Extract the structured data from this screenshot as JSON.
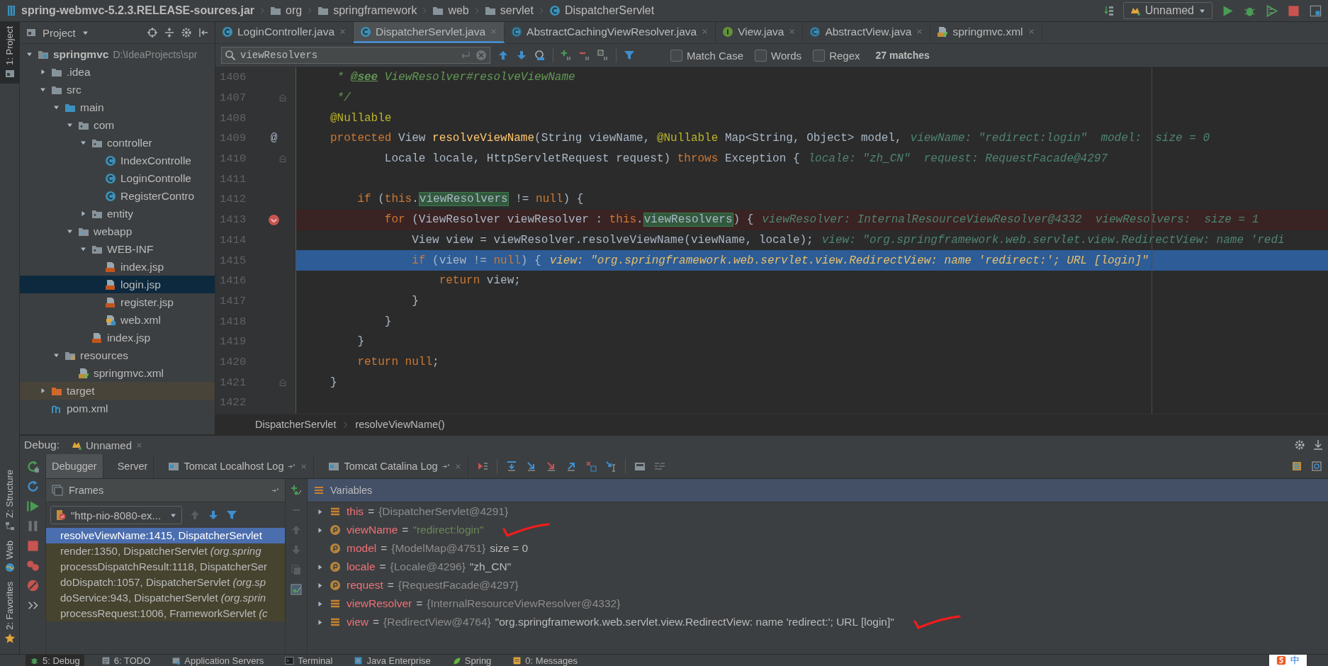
{
  "breadcrumb": [
    {
      "kind": "jar",
      "label": "spring-webmvc-5.2.3.RELEASE-sources.jar"
    },
    {
      "kind": "folder",
      "label": "org"
    },
    {
      "kind": "folder",
      "label": "springframework"
    },
    {
      "kind": "folder",
      "label": "web"
    },
    {
      "kind": "folder",
      "label": "servlet"
    },
    {
      "kind": "class",
      "label": "DispatcherServlet"
    }
  ],
  "run_config": {
    "label": "Unnamed"
  },
  "left_tools_top": [
    {
      "label": "1: Project",
      "kind": "project",
      "selected": true
    }
  ],
  "left_tools_bottom": [
    {
      "label": "Z: Structure",
      "kind": "structure",
      "selected": false
    },
    {
      "label": "Web",
      "kind": "web",
      "selected": false
    },
    {
      "label": "2: Favorites",
      "kind": "favorites",
      "selected": false
    }
  ],
  "project": {
    "title": "Project",
    "tree": [
      {
        "label": "springmvc",
        "path": "D:\\IdeaProjects\\spr",
        "kind": "module",
        "expanded": true,
        "selected": false,
        "children": [
          {
            "label": ".idea",
            "kind": "folder",
            "expanded": false,
            "selected": false
          },
          {
            "label": "src",
            "kind": "folder",
            "expanded": true,
            "selected": false,
            "children": [
              {
                "label": "main",
                "kind": "source",
                "expanded": true,
                "selected": false,
                "children": [
                  {
                    "label": "com",
                    "kind": "package",
                    "expanded": true,
                    "selected": false,
                    "children": [
                      {
                        "label": "controller",
                        "kind": "package",
                        "expanded": true,
                        "selected": false,
                        "children": [
                          {
                            "label": "IndexControlle",
                            "kind": "class",
                            "selected": false
                          },
                          {
                            "label": "LoginControlle",
                            "kind": "class",
                            "selected": false
                          },
                          {
                            "label": "RegisterContro",
                            "kind": "class",
                            "selected": false
                          }
                        ]
                      },
                      {
                        "label": "entity",
                        "kind": "package",
                        "expanded": false,
                        "selected": false
                      }
                    ]
                  },
                  {
                    "label": "webapp",
                    "kind": "webfolder",
                    "expanded": true,
                    "selected": false,
                    "children": [
                      {
                        "label": "WEB-INF",
                        "kind": "package",
                        "expanded": true,
                        "selected": false,
                        "children": [
                          {
                            "label": "index.jsp",
                            "kind": "jsp",
                            "selected": false
                          },
                          {
                            "label": "login.jsp",
                            "kind": "jsp",
                            "selected": true
                          },
                          {
                            "label": "register.jsp",
                            "kind": "jsp",
                            "selected": false
                          },
                          {
                            "label": "web.xml",
                            "kind": "webxml",
                            "selected": false
                          }
                        ]
                      },
                      {
                        "label": "index.jsp",
                        "kind": "jsp",
                        "selected": false
                      }
                    ]
                  }
                ]
              },
              {
                "label": "resources",
                "kind": "resources",
                "expanded": true,
                "selected": false,
                "children": [
                  {
                    "label": "springmvc.xml",
                    "kind": "springxml",
                    "selected": false
                  }
                ]
              }
            ]
          },
          {
            "label": "target",
            "kind": "excluded",
            "expanded": false,
            "selected": false
          },
          {
            "label": "pom.xml",
            "kind": "maven",
            "selected": false
          }
        ]
      }
    ]
  },
  "editor_tabs": [
    {
      "label": "LoginController.java",
      "kind": "class",
      "selected": false
    },
    {
      "label": "DispatcherServlet.java",
      "kind": "class",
      "selected": true
    },
    {
      "label": "AbstractCachingViewResolver.java",
      "kind": "abstract",
      "selected": false
    },
    {
      "label": "View.java",
      "kind": "interface",
      "selected": false
    },
    {
      "label": "AbstractView.java",
      "kind": "abstract",
      "selected": false
    },
    {
      "label": "springmvc.xml",
      "kind": "springxml",
      "selected": false
    }
  ],
  "find": {
    "value": "viewResolvers",
    "options": [
      {
        "label": "Match Case",
        "checked": false
      },
      {
        "label": "Words",
        "checked": false
      },
      {
        "label": "Regex",
        "checked": false
      }
    ],
    "matches": "27 matches"
  },
  "code": {
    "lines": [
      {
        "number": "1406",
        "tokens": [
          {
            "kind": "comment",
            "text": " * "
          },
          {
            "kind": "doctag",
            "text": "@see"
          },
          {
            "kind": "comment",
            "text": " ViewResolver#resolveViewName"
          }
        ]
      },
      {
        "number": "1407",
        "fold": true,
        "tokens": [
          {
            "kind": "comment",
            "text": " */"
          }
        ]
      },
      {
        "number": "1408",
        "tokens": [
          {
            "kind": "annotation",
            "text": "@Nullable"
          }
        ]
      },
      {
        "number": "1409",
        "gutter": "@",
        "tokens": [
          {
            "kind": "keyword",
            "text": "protected"
          },
          {
            "kind": "plain",
            "text": " View "
          },
          {
            "kind": "method",
            "text": "resolveViewName"
          },
          {
            "kind": "plain",
            "text": "(String viewName, "
          },
          {
            "kind": "annotation",
            "text": "@Nullable"
          },
          {
            "kind": "plain",
            "text": " Map<String, Object> model,"
          }
        ],
        "hint": "viewName: \"redirect:login\"  model:  size = 0"
      },
      {
        "number": "1410",
        "fold": true,
        "tokens": [
          {
            "kind": "plain",
            "text": "        Locale locale, HttpServletRequest request) "
          },
          {
            "kind": "keyword",
            "text": "throws"
          },
          {
            "kind": "plain",
            "text": " Exception {"
          }
        ],
        "hint": "locale: \"zh_CN\"  request: RequestFacade@4297"
      },
      {
        "number": "1411"
      },
      {
        "number": "1412",
        "tokens": [
          {
            "kind": "keyword",
            "text": "    if"
          },
          {
            "kind": "plain",
            "text": " ("
          },
          {
            "kind": "keyword",
            "text": "this"
          },
          {
            "kind": "plain",
            "text": "."
          },
          {
            "kind": "match",
            "text": "viewResolvers"
          },
          {
            "kind": "plain",
            "text": " != "
          },
          {
            "kind": "keyword",
            "text": "null"
          },
          {
            "kind": "plain",
            "text": ") {"
          }
        ]
      },
      {
        "number": "1413",
        "breakpoint": true,
        "tokens": [
          {
            "kind": "keyword",
            "text": "        for"
          },
          {
            "kind": "plain",
            "text": " (ViewResolver viewResolver : "
          },
          {
            "kind": "keyword",
            "text": "this"
          },
          {
            "kind": "plain",
            "text": "."
          },
          {
            "kind": "match",
            "text": "viewResolvers"
          },
          {
            "kind": "plain",
            "text": ") {"
          }
        ],
        "hint": "viewResolver: InternalResourceViewResolver@4332  viewResolvers:  size = 1"
      },
      {
        "number": "1414",
        "tokens": [
          {
            "kind": "plain",
            "text": "            View view = viewResolver.resolveViewName(viewName, locale);"
          }
        ],
        "hint": "view: \"org.springframework.web.servlet.view.RedirectView: name 'redi"
      },
      {
        "number": "1415",
        "current": true,
        "tokens": [
          {
            "kind": "keyword",
            "text": "            if"
          },
          {
            "kind": "plain",
            "text": " (view != "
          },
          {
            "kind": "keyword",
            "text": "null"
          },
          {
            "kind": "plain",
            "text": ") {"
          }
        ],
        "hint": "view: \"org.springframework.web.servlet.view.RedirectView: name 'redirect:'; URL [login]\""
      },
      {
        "number": "1416",
        "tokens": [
          {
            "kind": "keyword",
            "text": "                return"
          },
          {
            "kind": "plain",
            "text": " view;"
          }
        ]
      },
      {
        "number": "1417",
        "tokens": [
          {
            "kind": "plain",
            "text": "            }"
          }
        ]
      },
      {
        "number": "1418",
        "tokens": [
          {
            "kind": "plain",
            "text": "        }"
          }
        ]
      },
      {
        "number": "1419",
        "tokens": [
          {
            "kind": "plain",
            "text": "    }"
          }
        ]
      },
      {
        "number": "1420",
        "tokens": [
          {
            "kind": "keyword",
            "text": "    return null"
          },
          {
            "kind": "plain",
            "text": ";"
          }
        ]
      },
      {
        "number": "1421",
        "fold": true,
        "tokens": [
          {
            "kind": "plain",
            "text": "}"
          }
        ]
      },
      {
        "number": "1422"
      }
    ],
    "breadcrumb": [
      "DispatcherServlet",
      "resolveViewName()"
    ]
  },
  "debug": {
    "title": "Debug:",
    "session": "Unnamed",
    "tabs": [
      {
        "label": "Debugger",
        "kind": "plain",
        "selected": true
      },
      {
        "label": "Server",
        "kind": "plain",
        "selected": false
      },
      {
        "label": "Tomcat Localhost Log",
        "kind": "log",
        "selected": false
      },
      {
        "label": "Tomcat Catalina Log",
        "kind": "log",
        "selected": false
      }
    ],
    "frames": {
      "title": "Frames",
      "thread": "\"http-nio-8080-ex...",
      "items": [
        {
          "text": "resolveViewName:1415, DispatcherServlet",
          "selected": true
        },
        {
          "text": "render:1350, DispatcherServlet *(org.spring*",
          "selected": false
        },
        {
          "text": "processDispatchResult:1118, DispatcherSer",
          "selected": false
        },
        {
          "text": "doDispatch:1057, DispatcherServlet *(org.sp*",
          "selected": false
        },
        {
          "text": "doService:943, DispatcherServlet *(org.sprin*",
          "selected": false
        },
        {
          "text": "processRequest:1006, FrameworkServlet *(c*",
          "selected": false
        }
      ]
    },
    "variables": {
      "title": "Variables",
      "items": [
        {
          "kind": "field",
          "expanded": false,
          "parts": [
            {
              "kind": "name",
              "text": "this"
            },
            {
              "kind": "op",
              "text": "="
            },
            {
              "kind": "ref",
              "text": "{DispatcherServlet@4291}"
            }
          ]
        },
        {
          "kind": "param",
          "expanded": false,
          "marked": true,
          "parts": [
            {
              "kind": "name",
              "text": "viewName"
            },
            {
              "kind": "op",
              "text": "="
            },
            {
              "kind": "string",
              "text": "\"redirect:login\""
            }
          ]
        },
        {
          "kind": "param",
          "parts": [
            {
              "kind": "name",
              "text": "model"
            },
            {
              "kind": "op",
              "text": "="
            },
            {
              "kind": "ref",
              "text": "{ModelMap@4751}"
            },
            {
              "kind": "detail",
              "text": "size = 0"
            }
          ]
        },
        {
          "kind": "param",
          "expanded": false,
          "parts": [
            {
              "kind": "name",
              "text": "locale"
            },
            {
              "kind": "op",
              "text": "="
            },
            {
              "kind": "ref",
              "text": "{Locale@4296}"
            },
            {
              "kind": "detail",
              "text": "\"zh_CN\""
            }
          ]
        },
        {
          "kind": "param",
          "expanded": false,
          "parts": [
            {
              "kind": "name",
              "text": "request"
            },
            {
              "kind": "op",
              "text": "="
            },
            {
              "kind": "ref",
              "text": "{RequestFacade@4297}"
            }
          ]
        },
        {
          "kind": "field",
          "expanded": false,
          "parts": [
            {
              "kind": "name",
              "text": "viewResolver"
            },
            {
              "kind": "op",
              "text": "="
            },
            {
              "kind": "ref",
              "text": "{InternalResourceViewResolver@4332}"
            }
          ]
        },
        {
          "kind": "field",
          "expanded": false,
          "marked": true,
          "parts": [
            {
              "kind": "name",
              "text": "view"
            },
            {
              "kind": "op",
              "text": "="
            },
            {
              "kind": "ref",
              "text": "{RedirectView@4764}"
            },
            {
              "kind": "detail",
              "text": "\"org.springframework.web.servlet.view.RedirectView: name 'redirect:'; URL [login]\""
            }
          ]
        }
      ]
    }
  },
  "bottom_tools": [
    {
      "label": "5: Debug",
      "kind": "debug",
      "selected": true
    },
    {
      "label": "6: TODO",
      "kind": "todo",
      "selected": false
    },
    {
      "label": "Application Servers",
      "kind": "servers",
      "selected": false
    },
    {
      "label": "Terminal",
      "kind": "terminal",
      "selected": false
    },
    {
      "label": "Java Enterprise",
      "kind": "enterprise",
      "selected": false
    },
    {
      "label": "Spring",
      "kind": "spring",
      "selected": false
    },
    {
      "label": "0: Messages",
      "kind": "messages",
      "selected": false
    }
  ],
  "ime": {
    "label": "中"
  }
}
